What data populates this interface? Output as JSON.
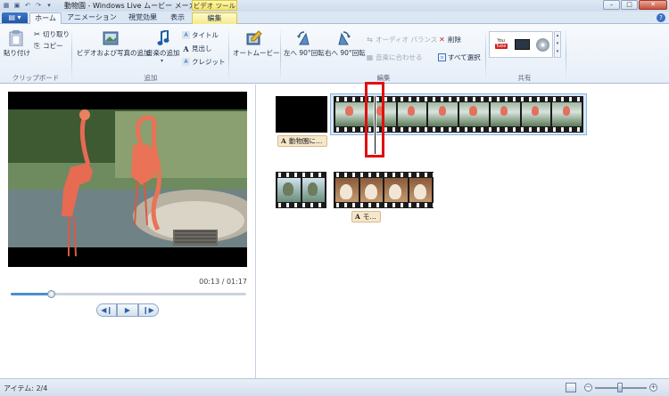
{
  "titlebar": {
    "title": "動物園 - Windows Live ムービー メーカー",
    "video_tools": "ビデオ ツール"
  },
  "tabs": {
    "home": "ホーム",
    "animation": "アニメーション",
    "visual_effects": "視覚効果",
    "view": "表示",
    "edit": "編集"
  },
  "ribbon": {
    "clipboard": {
      "group": "クリップボード",
      "paste": "貼り付け",
      "cut": "切り取り",
      "copy": "コピー"
    },
    "add": {
      "group": "追加",
      "add_videos_photos": "ビデオおよび写真の追加",
      "add_music": "音楽の追加",
      "title": "タイトル",
      "caption": "見出し",
      "credits": "クレジット"
    },
    "automovie": "オートムービー",
    "editing": {
      "group": "編集",
      "rotate_left": "左へ 90°回転",
      "rotate_right": "右へ 90°回転",
      "audio_balance": "オーディオ バランス",
      "fit_to_music": "音楽に合わせる",
      "delete": "削除",
      "select_all": "すべて選択"
    },
    "share": {
      "group": "共有"
    }
  },
  "preview": {
    "time": "00:13 / 01:17",
    "progress": 0.17
  },
  "storyboard": {
    "caption1": "動物園に…",
    "caption2": "モ…"
  },
  "statusbar": {
    "items": "アイテム: 2/4"
  },
  "colors": {
    "accent": "#1f56a8",
    "highlight": "#e01010",
    "video_tools": "#f3e36c"
  }
}
